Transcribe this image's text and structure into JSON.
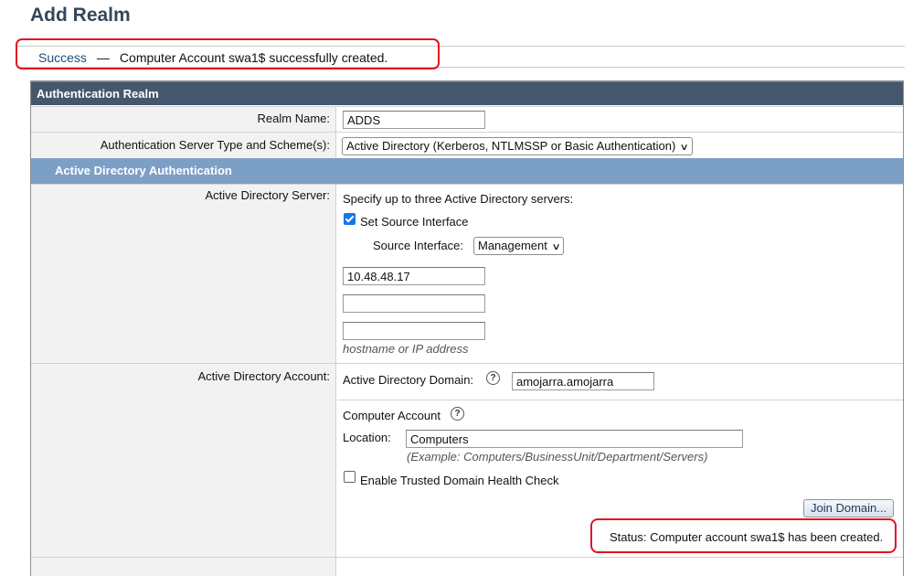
{
  "page": {
    "title": "Add Realm"
  },
  "notice": {
    "status": "Success",
    "separator": "—",
    "message": "Computer Account swa1$ successfully created."
  },
  "panel": {
    "header": "Authentication Realm",
    "realm_name": {
      "label": "Realm Name:",
      "value": "ADDS"
    },
    "server_type": {
      "label": "Authentication Server Type and Scheme(s):",
      "selected": "Active Directory (Kerberos, NTLMSSP or Basic Authentication)"
    },
    "ad_section": {
      "header": "Active Directory Authentication",
      "server": {
        "label": "Active Directory Server:",
        "instruction": "Specify up to three Active Directory servers:",
        "set_source_interface": {
          "label": "Set Source Interface",
          "checked": true
        },
        "source_interface": {
          "label": "Source Interface:",
          "selected": "Management"
        },
        "servers": [
          "10.48.48.17",
          "",
          ""
        ],
        "hint": "hostname or IP address"
      },
      "account": {
        "label": "Active Directory Account:",
        "domain": {
          "label": "Active Directory Domain:",
          "value": "amojarra.amojarra"
        },
        "computer_account": {
          "label": "Computer Account",
          "location_label": "Location:",
          "location_value": "Computers",
          "location_example": "(Example: Computers/BusinessUnit/Department/Servers)"
        },
        "health_check": {
          "label": "Enable Trusted Domain Health Check",
          "checked": false
        },
        "join_button": "Join Domain...",
        "status": "Status: Computer account swa1$ has been created."
      }
    }
  },
  "colors": {
    "title": "#33475b",
    "panel_header_bg": "#44576c",
    "sub_header_bg": "#7c9fc6",
    "highlight_border": "#e0141e",
    "success_link": "#1f4f7a",
    "checkbox_checked": "#1a73e8"
  },
  "icons": [
    "help-icon",
    "chevron-down-icon",
    "checkbox-checked-icon",
    "checkbox-unchecked-icon"
  ]
}
